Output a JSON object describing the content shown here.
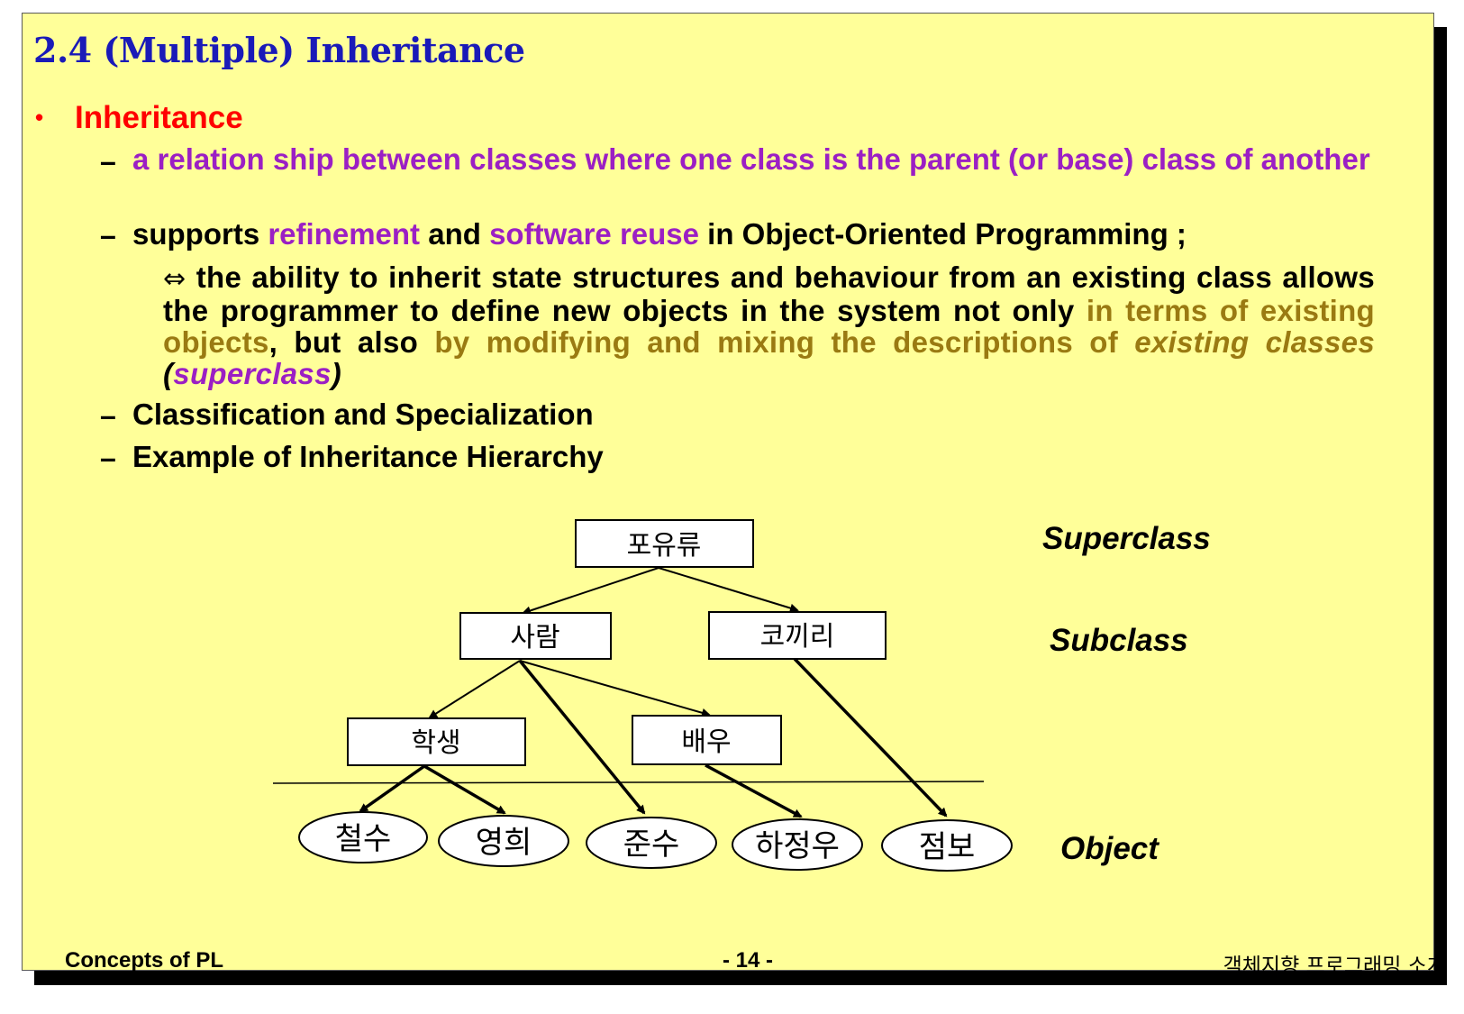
{
  "slide": {
    "title": "2.4 (Multiple) Inheritance",
    "bullet": "Inheritance",
    "subs": {
      "relation_pre": " a relation ship between classes where one class is the parent (or base) class of another",
      "supports_1": "supports ",
      "supports_2": "refinement",
      "supports_3": " and ",
      "supports_4": "software reuse",
      "supports_5": " in Object-Oriented Programming ;",
      "ability_symbol": "⇔",
      "ability_1": " the ability to inherit state structures and behaviour from an existing class allows the programmer to define new objects in the system not only ",
      "ability_2": "in terms of existing objects",
      "ability_3": ", but also ",
      "ability_4": "by modifying and mixing the descriptions of ",
      "ability_5": "existing classes",
      "ability_6": " (",
      "ability_7": "superclass",
      "ability_8": ")",
      "classification": "Classification and Specialization",
      "example": "Example of Inheritance Hierarchy"
    },
    "dash": "–"
  },
  "diagram": {
    "nodes": {
      "root": "포유류",
      "person": "사람",
      "elephant": "코끼리",
      "student": "학생",
      "actor": "배우"
    },
    "objects": [
      "철수",
      "영희",
      "준수",
      "하정우",
      "점보"
    ],
    "levels": {
      "superclass": "Superclass",
      "subclass": "Subclass",
      "object": "Object"
    }
  },
  "footer": {
    "left": "Concepts of PL",
    "center": "- 14 -",
    "right": "객체지향 프로그래밍 소개"
  }
}
